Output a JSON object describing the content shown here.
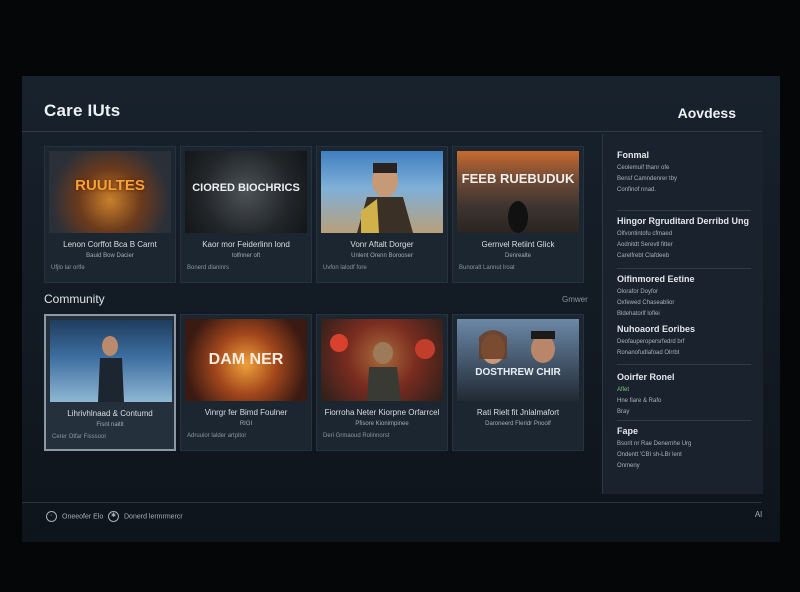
{
  "header": {
    "title": "Care IUts",
    "right_label": "Aovdess"
  },
  "colors": {
    "background": "#050607",
    "panel": "#18222d",
    "card": "#1c2631",
    "selected_border": "#8d98a5"
  },
  "sections": [
    {
      "label": "",
      "cards": [
        {
          "thumb": "RUULTES",
          "title": "Lenon Corffot Bca B Carnt",
          "subtitle": "Bauid Bow Dacier",
          "meta": "Ufjlo lar orlfe"
        },
        {
          "thumb": "CIORED BIOCHRICS",
          "title": "Kaor mor Feiderlinn lond",
          "subtitle": "tolfnner oft",
          "meta": "Bonerd dlaninrs"
        },
        {
          "thumb": "",
          "title": "Vonr Aftalt Dorger",
          "subtitle": "Unlent Orenn Borooser",
          "meta": "Uvfon lalodf fore"
        },
        {
          "thumb": "FEEB RUEBUDUK",
          "title": "Gernvel Retiint Glick",
          "subtitle": "Denrealte",
          "meta": "Bunoralt Lannut lroat"
        }
      ]
    },
    {
      "label": "Community",
      "more": "Gmwer",
      "cards": [
        {
          "thumb": "",
          "title": "Lihrivhlnaad & Contumd",
          "subtitle": "Fisnt naitit",
          "meta": "Cerer Otfar Fisssoor",
          "selected": true
        },
        {
          "thumb": "DAM NER",
          "title": "Vinrgr fer Bimd Foulner",
          "subtitle": "RIGI",
          "meta": "Adruuior lalder artpitor"
        },
        {
          "thumb": "",
          "title": "Fiorroha Neter Kiorpne Orfarrcel",
          "subtitle": "Pfisore Kionimpinee",
          "meta": "Deri Grmaoud Rolinnorst"
        },
        {
          "thumb": "DOSTHREW CHIR",
          "title": "Rati Rielt fit Jnlalmafort",
          "subtitle": "Daroneerd Fleridr Pnoolf",
          "meta": ""
        }
      ]
    }
  ],
  "sidebar": {
    "groups": [
      {
        "head": "Fonmal",
        "lines": [
          "Ceolemuif thanr ofe",
          "Bensf Camndenrer tby",
          "Confinof nnad."
        ],
        "green": []
      },
      {
        "head": "Hingor Rgruditard Derribd Ung",
        "lines": [
          "Olfvontintofu cfmaed",
          "Aodnitdt Serevtl fitter",
          "Carelfrebt Clafdeeb"
        ],
        "green": []
      },
      {
        "head": "Oifinmored Eetine",
        "lines": [
          "Olorafor Doyfor",
          "Oxfewed Chaseablior",
          "Bldehatorlf loflei"
        ],
        "green": []
      },
      {
        "head": "Nuhoaord Eoribes",
        "lines": [
          "Deofauperopersrfedrd brf",
          "Ronanofudlafoad Olrrbt"
        ],
        "green": []
      },
      {
        "head": "Ooirfer Ronel",
        "lines": [
          "Hne fiare & Rafo",
          "Bray"
        ],
        "green": [
          "Aflet"
        ]
      },
      {
        "head": "Fape",
        "lines": [
          "Bsorit nr Rae Denernhe Urg",
          "Ondentt 'CBI sh-LBr lent",
          "Onmeny"
        ],
        "green": []
      }
    ]
  },
  "footer": {
    "left_1": "Oneeofer Elo",
    "left_2": "Donerd lermrmercr",
    "right": "Al"
  }
}
